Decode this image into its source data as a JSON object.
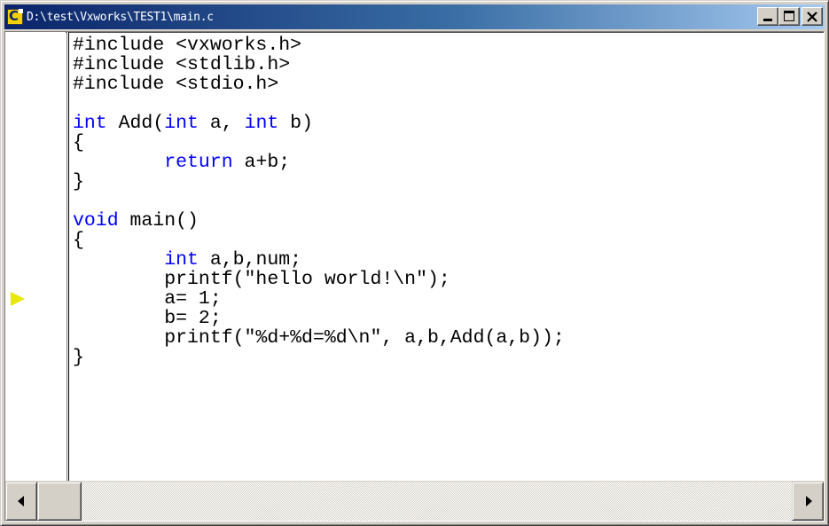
{
  "window": {
    "title": "D:\\test\\Vxworks\\TEST1\\main.c",
    "buttons": [
      "minimize",
      "maximize",
      "close"
    ]
  },
  "editor": {
    "current_line_index": 13,
    "lines": [
      [
        {
          "t": "#include <vxworks.h>"
        }
      ],
      [
        {
          "t": "#include <stdlib.h>"
        }
      ],
      [
        {
          "t": "#include <stdio.h>"
        }
      ],
      [
        {
          "t": ""
        }
      ],
      [
        {
          "t": "int",
          "kw": true
        },
        {
          "t": " Add("
        },
        {
          "t": "int",
          "kw": true
        },
        {
          "t": " a, "
        },
        {
          "t": "int",
          "kw": true
        },
        {
          "t": " b)"
        }
      ],
      [
        {
          "t": "{"
        }
      ],
      [
        {
          "t": "        "
        },
        {
          "t": "return",
          "kw": true
        },
        {
          "t": " a+b;"
        }
      ],
      [
        {
          "t": "}"
        }
      ],
      [
        {
          "t": ""
        }
      ],
      [
        {
          "t": "void",
          "kw": true
        },
        {
          "t": " main()"
        }
      ],
      [
        {
          "t": "{"
        }
      ],
      [
        {
          "t": "        "
        },
        {
          "t": "int",
          "kw": true
        },
        {
          "t": " a,b,num;"
        }
      ],
      [
        {
          "t": "        printf(\"hello world!\\n\");"
        }
      ],
      [
        {
          "t": "        a= 1;"
        }
      ],
      [
        {
          "t": "        b= 2;"
        }
      ],
      [
        {
          "t": "        printf(\"%d+%d=%d\\n\", a,b,Add(a,b));"
        }
      ],
      [
        {
          "t": "}"
        }
      ]
    ]
  },
  "colors": {
    "keyword": "#0000ff",
    "text": "#000000",
    "execution_marker": "#e8e800"
  },
  "icons": {
    "app": "c-source-file-icon",
    "marker": "current-line-arrow-icon"
  }
}
